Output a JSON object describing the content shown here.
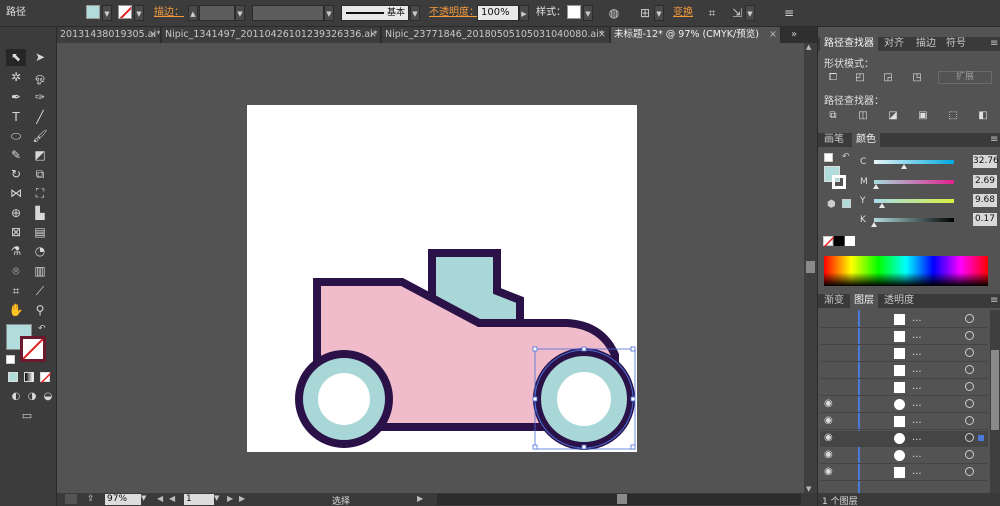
{
  "control_bar": {
    "object_type": "路径",
    "fill_color": "#b2dcdc",
    "stroke_label": "描边：",
    "stroke_style_label": "基本",
    "opacity_label": "不透明度：",
    "opacity_value": "100%",
    "style_label": "样式：",
    "transform_label": "变换"
  },
  "tabs": [
    {
      "label": "20131438019305.ai*",
      "active": false
    },
    {
      "label": "Nipic_1341497_20110426101239326336.ai*",
      "active": false
    },
    {
      "label": "Nipic_23771846_20180505105031040080.ai*",
      "active": false
    },
    {
      "label": "未标题-12* @ 97% (CMYK/预览)",
      "active": true
    }
  ],
  "toolbox": {
    "fill_color": "#b2dcdc",
    "tools": [
      "selection-tool",
      "direct-selection-tool",
      "magic-wand-tool",
      "lasso-tool",
      "pen-tool",
      "curvature-tool",
      "type-tool",
      "line-tool",
      "ellipse-tool",
      "paintbrush-tool",
      "pencil-tool",
      "eraser-tool",
      "rotate-tool",
      "scale-tool",
      "width-tool",
      "free-transform-tool",
      "shape-builder-tool",
      "perspective-grid-tool",
      "mesh-tool",
      "gradient-tool",
      "eyedropper-tool",
      "blend-tool",
      "symbol-sprayer-tool",
      "column-graph-tool",
      "artboard-tool",
      "slice-tool",
      "hand-tool",
      "zoom-tool"
    ]
  },
  "artwork": {
    "body_color": "#f0bccb",
    "window_color": "#a9d6d6",
    "wheel_color": "#a9d6d6",
    "hub_color": "#ffffff",
    "outline_color": "#2a1148",
    "selection_color": "#4a6fd8"
  },
  "status_bar": {
    "zoom": "97%",
    "page": "1",
    "tool_name": "选择"
  },
  "pathfinder_panel": {
    "tabs": [
      "路径查找器",
      "对齐",
      "描边",
      "符号"
    ],
    "shape_modes_label": "形状模式：",
    "expand_label": "扩展",
    "pathfinders_label": "路径查找器："
  },
  "color_panel": {
    "tabs": [
      "画笔",
      "颜色"
    ],
    "channels": [
      {
        "name": "C",
        "value": "32.76",
        "fraction": 0.33
      },
      {
        "name": "M",
        "value": "2.69",
        "fraction": 0.03
      },
      {
        "name": "Y",
        "value": "9.68",
        "fraction": 0.1
      },
      {
        "name": "K",
        "value": "0.17",
        "fraction": 0.0
      }
    ],
    "percent_sign": "%",
    "swatch_color": "#b2dcdc"
  },
  "layers_panel": {
    "tabs": [
      "渐变",
      "图层",
      "透明度"
    ],
    "row_dots": "...",
    "footer_label": "1 个图层"
  }
}
